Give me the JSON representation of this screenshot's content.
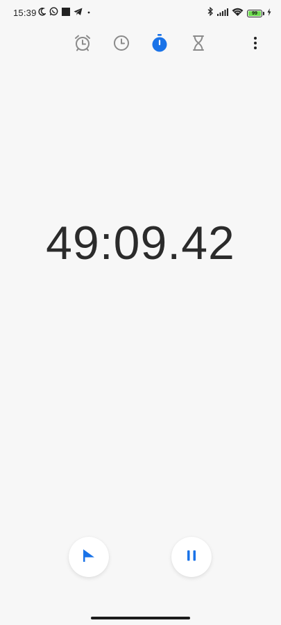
{
  "status_bar": {
    "time": "15:39",
    "battery_level": "99",
    "left_icons": [
      "moon-icon",
      "whatsapp-icon",
      "square-notification-icon",
      "telegram-icon",
      "dot-icon"
    ],
    "right_icons": [
      "bluetooth-icon",
      "signal-icon",
      "wifi-icon",
      "battery-icon",
      "charging-icon"
    ]
  },
  "tabs": [
    {
      "icon": "alarm-icon",
      "active": false
    },
    {
      "icon": "clock-icon",
      "active": false
    },
    {
      "icon": "stopwatch-icon",
      "active": true
    },
    {
      "icon": "timer-hourglass-icon",
      "active": false
    }
  ],
  "stopwatch": {
    "elapsed": "49:09.42"
  },
  "controls": {
    "lap_icon": "flag-icon",
    "pause_icon": "pause-icon"
  },
  "colors": {
    "accent": "#1a73e8",
    "inactive_icon": "#8a8a8a",
    "background": "#f7f7f7",
    "battery_fill": "#6ddc4f"
  }
}
